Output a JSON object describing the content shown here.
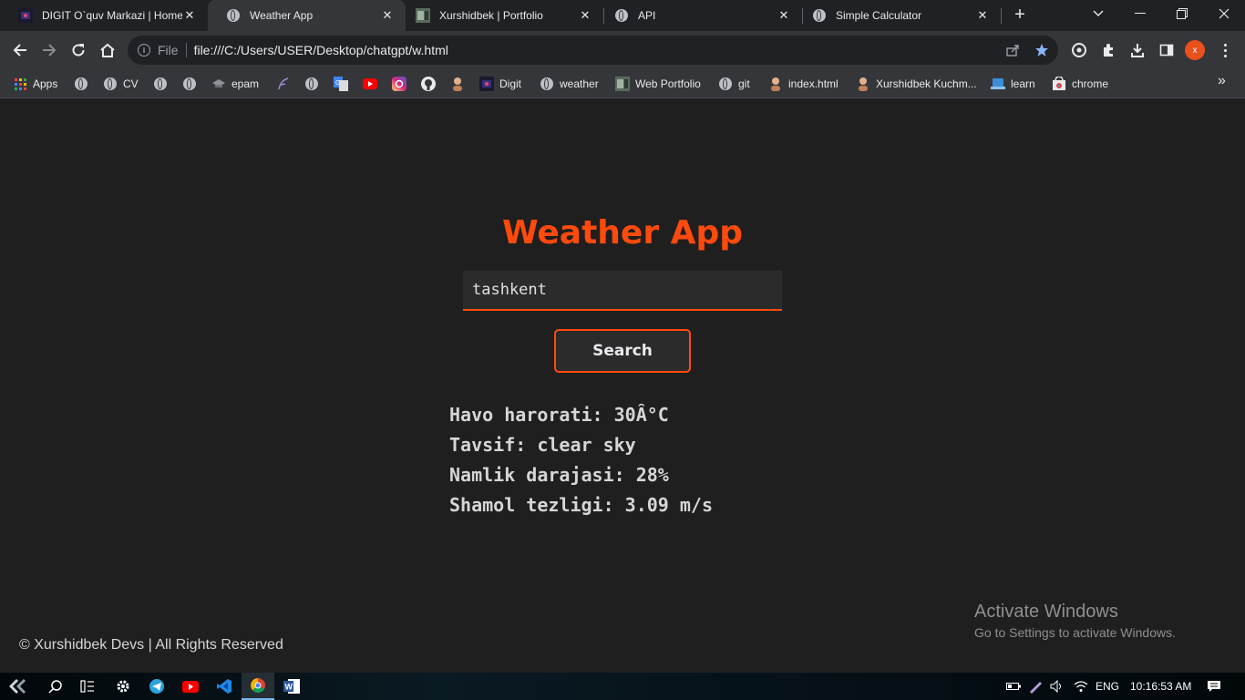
{
  "tabs": [
    {
      "title": "DIGIT O`quv Markazi | Home",
      "icon": "digit-favicon",
      "active": false
    },
    {
      "title": "Weather App",
      "icon": "globe-icon",
      "active": true
    },
    {
      "title": "Xurshidbek | Portfolio",
      "icon": "portfolio-favicon",
      "active": false
    },
    {
      "title": "API",
      "icon": "globe-icon",
      "active": false
    },
    {
      "title": "Simple Calculator",
      "icon": "globe-icon",
      "active": false
    }
  ],
  "omnibox": {
    "scheme_label": "File",
    "url": "file:///C:/Users/USER/Desktop/chatgpt/w.html"
  },
  "profile_initial": "x",
  "bookmarks": [
    {
      "label": "Apps",
      "icon": "apps-grid-icon"
    },
    {
      "label": "",
      "icon": "globe-icon"
    },
    {
      "label": "CV",
      "icon": "globe-icon"
    },
    {
      "label": "",
      "icon": "globe-icon"
    },
    {
      "label": "",
      "icon": "globe-icon"
    },
    {
      "label": "epam",
      "icon": "graduation-cap-icon"
    },
    {
      "label": "",
      "icon": "feather-icon"
    },
    {
      "label": "",
      "icon": "globe-icon"
    },
    {
      "label": "",
      "icon": "google-translate-icon"
    },
    {
      "label": "",
      "icon": "youtube-icon"
    },
    {
      "label": "",
      "icon": "instagram-icon"
    },
    {
      "label": "",
      "icon": "github-icon"
    },
    {
      "label": "",
      "icon": "avatar-icon"
    },
    {
      "label": "Digit",
      "icon": "digit-favicon"
    },
    {
      "label": "weather",
      "icon": "globe-icon"
    },
    {
      "label": "Web Portfolio",
      "icon": "portfolio-favicon"
    },
    {
      "label": "git",
      "icon": "globe-icon"
    },
    {
      "label": "index.html",
      "icon": "avatar-icon"
    },
    {
      "label": "Xurshidbek Kuchm...",
      "icon": "avatar-icon"
    },
    {
      "label": "learn",
      "icon": "laptop-icon"
    },
    {
      "label": "chrome",
      "icon": "chrome-store-icon"
    }
  ],
  "app": {
    "title": "Weather App",
    "search_value": "tashkent",
    "search_button": "Search",
    "results": [
      "Havo harorati: 30Â°C",
      "Tavsif: clear sky",
      "Namlik darajasi: 28%",
      "Shamol tezligi: 3.09 m/s"
    ],
    "footer": "© Xurshidbek Devs | All Rights Reserved"
  },
  "watermark": {
    "line1": "Activate Windows",
    "line2": "Go to Settings to activate Windows."
  },
  "taskbar": {
    "language": "ENG",
    "time": "10:16:53 AM"
  },
  "colors": {
    "accent": "#ff4a0d",
    "page_bg": "#1f1f1f",
    "input_bg": "#2b2b2b",
    "text": "#d6d6d6"
  }
}
